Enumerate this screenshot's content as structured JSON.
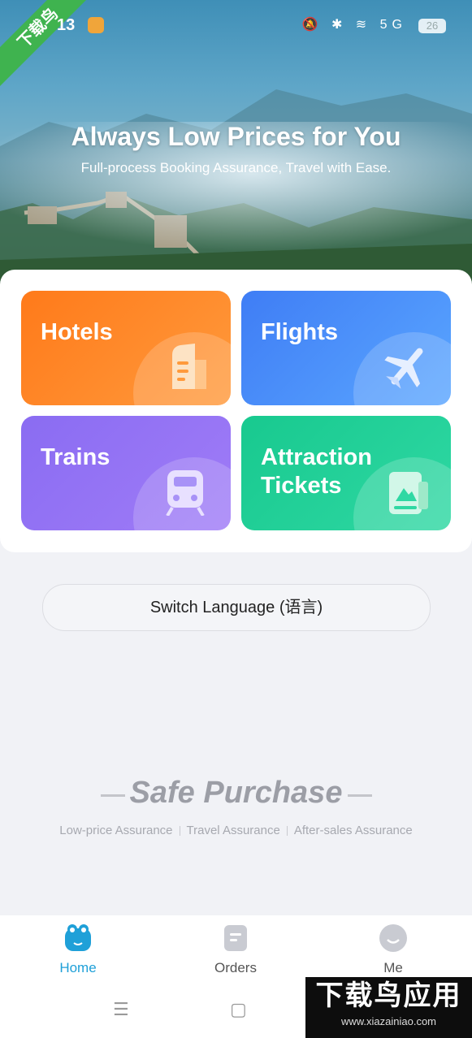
{
  "status": {
    "time": "13",
    "icons": "🔕 ✱ ≋ 5G",
    "battery": "26"
  },
  "ribbon": "下载鸟",
  "hero": {
    "title": "Always Low Prices for You",
    "subtitle": "Full-process Booking Assurance, Travel with Ease."
  },
  "tiles": [
    {
      "label": "Hotels",
      "icon": "hotel-icon",
      "color": "#ff7a1a"
    },
    {
      "label": "Flights",
      "icon": "plane-icon",
      "color": "#3f7df5"
    },
    {
      "label": "Trains",
      "icon": "train-icon",
      "color": "#8a6cf2"
    },
    {
      "label": "Attraction Tickets",
      "icon": "ticket-icon",
      "color": "#18c98f"
    }
  ],
  "switch_language": "Switch Language (语言)",
  "safe": {
    "title": "Safe Purchase",
    "items": [
      "Low-price Assurance",
      "Travel Assurance",
      "After-sales Assurance"
    ]
  },
  "tabbar": {
    "items": [
      {
        "label": "Home",
        "icon": "home-icon",
        "active": true
      },
      {
        "label": "Orders",
        "icon": "orders-icon"
      },
      {
        "label": "Me",
        "icon": "profile-icon"
      }
    ],
    "accent": "#1fa0d8"
  },
  "navkeys": {
    "menu": "☰",
    "home": "▢"
  },
  "watermark": {
    "title": "下载鸟应用",
    "url": "www.xiazainiao.com"
  }
}
